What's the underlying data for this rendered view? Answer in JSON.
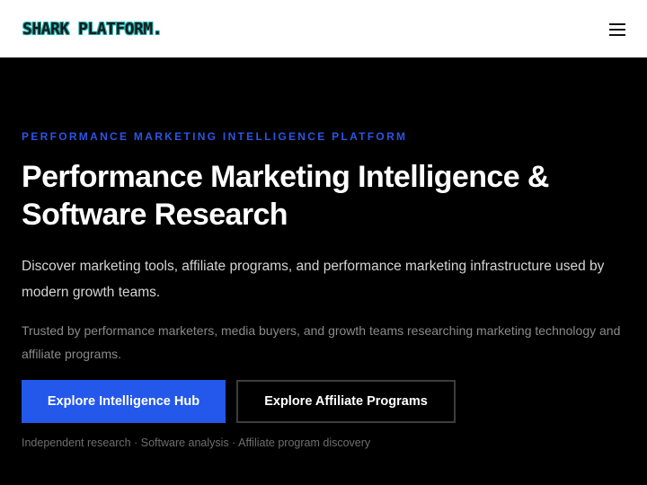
{
  "header": {
    "logo_text": "SHARK PLATFORM.",
    "menu_icon": "hamburger-menu-icon"
  },
  "hero": {
    "eyebrow": "PERFORMANCE MARKETING INTELLIGENCE PLATFORM",
    "headline": "Performance Marketing Intelligence & Software Research",
    "lead": "Discover marketing tools, affiliate programs, and performance marketing infrastructure used by modern growth teams.",
    "trust": "Trusted by performance marketers, media buyers, and growth teams researching marketing technology and affiliate programs.",
    "primary_button": "Explore Intelligence Hub",
    "secondary_button": "Explore Affiliate Programs",
    "footnote": "Independent research · Software analysis · Affiliate program discovery"
  },
  "colors": {
    "accent": "#2458ea",
    "eyebrow": "#2b55e6",
    "background": "#000000",
    "header_bg": "#ffffff"
  }
}
